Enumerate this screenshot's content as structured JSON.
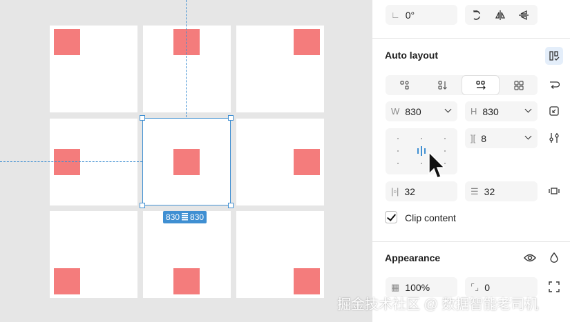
{
  "rotation": {
    "icon": "angle-icon",
    "value": "0°"
  },
  "auto_layout": {
    "title": "Auto layout",
    "directions": [
      "free-layout-icon",
      "vertical-icon",
      "horizontal-icon",
      "grid-icon"
    ],
    "width": {
      "label": "W",
      "value": "830"
    },
    "height": {
      "label": "H",
      "value": "830"
    },
    "gap": {
      "value": "8"
    },
    "padding_h": {
      "value": "32"
    },
    "padding_v": {
      "value": "32"
    },
    "clip_content": {
      "label": "Clip content",
      "checked": true
    }
  },
  "appearance": {
    "title": "Appearance",
    "opacity": "100%",
    "radius": "0"
  },
  "selection_badge": {
    "w": "830",
    "h": "830"
  },
  "watermark": "掘金技术社区 @ 数据智能老司机",
  "colors": {
    "square": "#f47c7c",
    "selection": "#3f8fd2"
  }
}
